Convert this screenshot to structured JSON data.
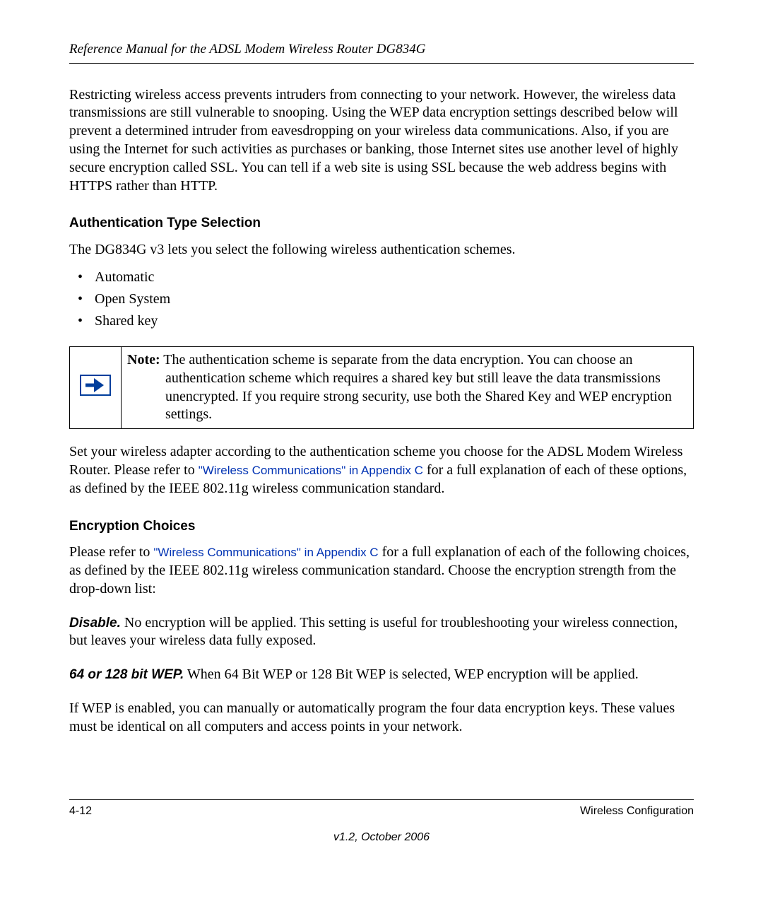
{
  "header": {
    "title": "Reference Manual for the ADSL Modem Wireless Router DG834G"
  },
  "body": {
    "intro": "Restricting wireless access prevents intruders from connecting to your network. However, the wireless data transmissions are still vulnerable to snooping. Using the WEP data encryption settings described below will prevent a determined intruder from eavesdropping on your wireless data communications. Also, if you are using the Internet for such activities as purchases or banking, those Internet sites use another level of highly secure encryption called SSL. You can tell if a web site is using SSL because the web address begins with HTTPS rather than HTTP.",
    "auth_heading": "Authentication Type Selection",
    "auth_intro": "The DG834G v3 lets you select the following wireless authentication schemes.",
    "auth_items": [
      "Automatic",
      "Open System",
      "Shared key"
    ],
    "note_label": "Note:",
    "note_first": " The authentication scheme is separate from the data encryption. You can choose an ",
    "note_rest": "authentication scheme which requires a shared key but still leave the data transmissions unencrypted. If you require strong security, use both the Shared Key and WEP encryption settings.",
    "after_note_pre": "Set your wireless adapter according to the authentication scheme you choose for the ADSL Modem Wireless Router. Please refer to ",
    "link1": "\"Wireless Communications\" in Appendix C",
    "after_note_post": " for a full explanation of each of these options, as defined by the IEEE 802.11g wireless communication standard.",
    "enc_heading": "Encryption Choices",
    "enc_pre": "Please refer to ",
    "link2": "\"Wireless Communications\" in Appendix C",
    "enc_post": " for a full explanation of each of the following choices, as defined by the IEEE 802.11g wireless communication standard. Choose the encryption strength from the drop-down list:",
    "disable_label": "Disable.",
    "disable_text": " No encryption will be applied. This setting is useful for troubleshooting your wireless connection, but leaves your wireless data fully exposed.",
    "wep_label": "64 or 128 bit WEP.",
    "wep_text": " When 64 Bit WEP or 128 Bit WEP is selected, WEP encryption will be applied.",
    "wep_followup": "If WEP is enabled, you can manually or automatically program the four data encryption keys. These values must be identical on all computers and access points in your network."
  },
  "footer": {
    "page_num": "4-12",
    "section": "Wireless Configuration",
    "version": "v1.2, October 2006"
  }
}
